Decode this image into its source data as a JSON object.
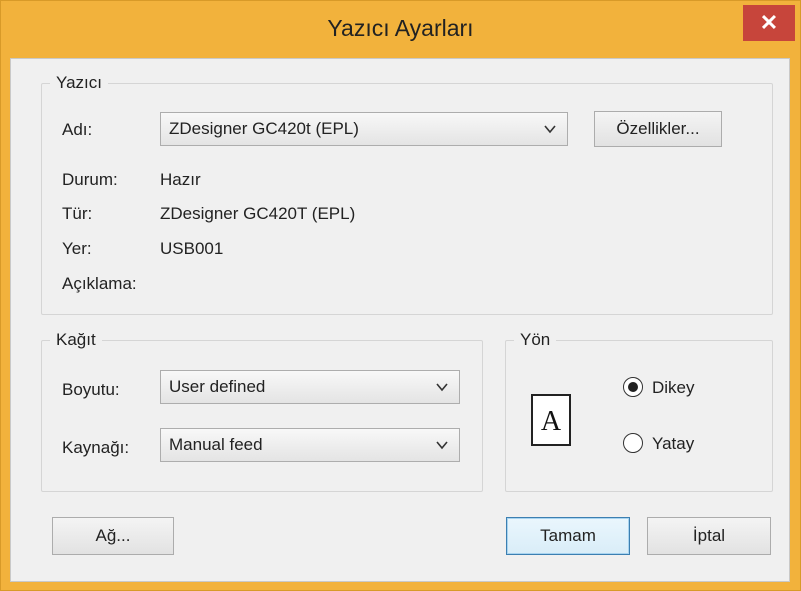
{
  "window": {
    "title": "Yazıcı Ayarları",
    "close_glyph": "✕"
  },
  "printer_group": {
    "legend": "Yazıcı",
    "name_label": "Adı:",
    "name_value": "ZDesigner GC420t (EPL)",
    "properties_button": "Özellikler...",
    "status_label": "Durum:",
    "status_value": "Hazır",
    "type_label": "Tür:",
    "type_value": "ZDesigner GC420T (EPL)",
    "location_label": "Yer:",
    "location_value": "USB001",
    "comment_label": "Açıklama:"
  },
  "paper_group": {
    "legend": "Kağıt",
    "size_label": "Boyutu:",
    "size_value": "User defined",
    "source_label": "Kaynağı:",
    "source_value": "Manual feed"
  },
  "orientation_group": {
    "legend": "Yön",
    "icon_letter": "A",
    "portrait_label": "Dikey",
    "landscape_label": "Yatay",
    "selected": "portrait"
  },
  "buttons": {
    "network": "Ağ...",
    "ok": "Tamam",
    "cancel": "İptal"
  },
  "colors": {
    "title_bar": "#f2b23c",
    "close_button": "#c7453b",
    "client_bg": "#f0f0f0"
  }
}
